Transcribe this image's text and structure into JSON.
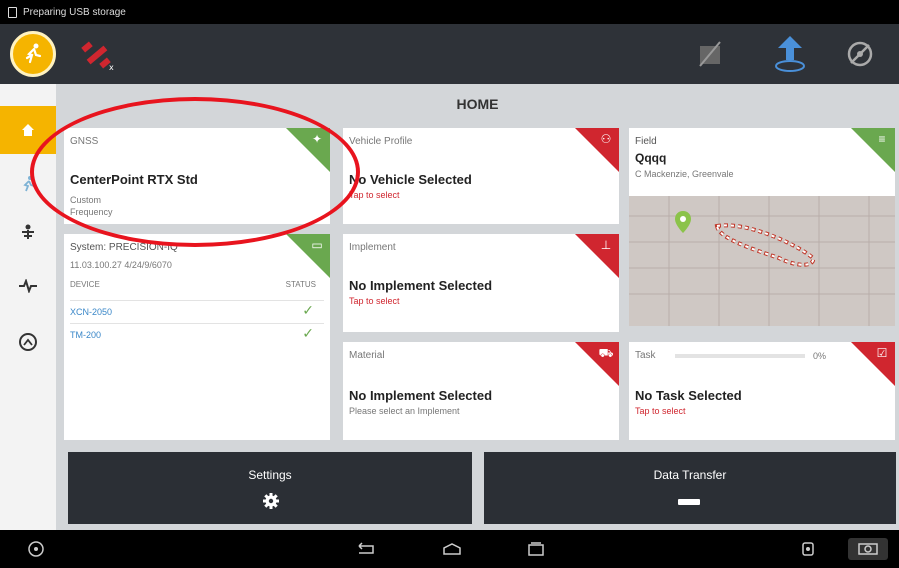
{
  "status_bar": {
    "notification": "Preparing USB storage"
  },
  "home": {
    "title": "HOME"
  },
  "gnss": {
    "label": "GNSS",
    "value": "CenterPoint RTX Std",
    "line1": "Custom",
    "line2": "Frequency"
  },
  "vehicle": {
    "label": "Vehicle Profile",
    "value": "No Vehicle Selected",
    "hint": "Tap to select"
  },
  "field": {
    "label": "Field",
    "name": "Qqqq",
    "location": "C Mackenzie, Greenvale"
  },
  "system": {
    "label": "System: PRECISION-IQ",
    "version": "11.03.100.27 4/24/9/6070",
    "col_device": "DEVICE",
    "col_status": "STATUS",
    "devices": [
      {
        "name": "XCN-2050",
        "status_icon": "check-icon"
      },
      {
        "name": "TM-200",
        "status_icon": "check-icon"
      }
    ]
  },
  "implement": {
    "label": "Implement",
    "value": "No Implement Selected",
    "hint": "Tap to select"
  },
  "material": {
    "label": "Material",
    "value": "No Implement Selected",
    "hint": "Please select an Implement"
  },
  "task": {
    "label": "Task",
    "progress": 0,
    "progress_text": "0%",
    "value": "No Task Selected",
    "hint": "Tap to select"
  },
  "bottom": {
    "settings_label": "Settings",
    "data_transfer_label": "Data Transfer"
  },
  "colors": {
    "accent": "#f5b400",
    "green": "#6aa84f",
    "red": "#d0262f",
    "dark": "#2e3238",
    "annotation": "#e8141e"
  }
}
